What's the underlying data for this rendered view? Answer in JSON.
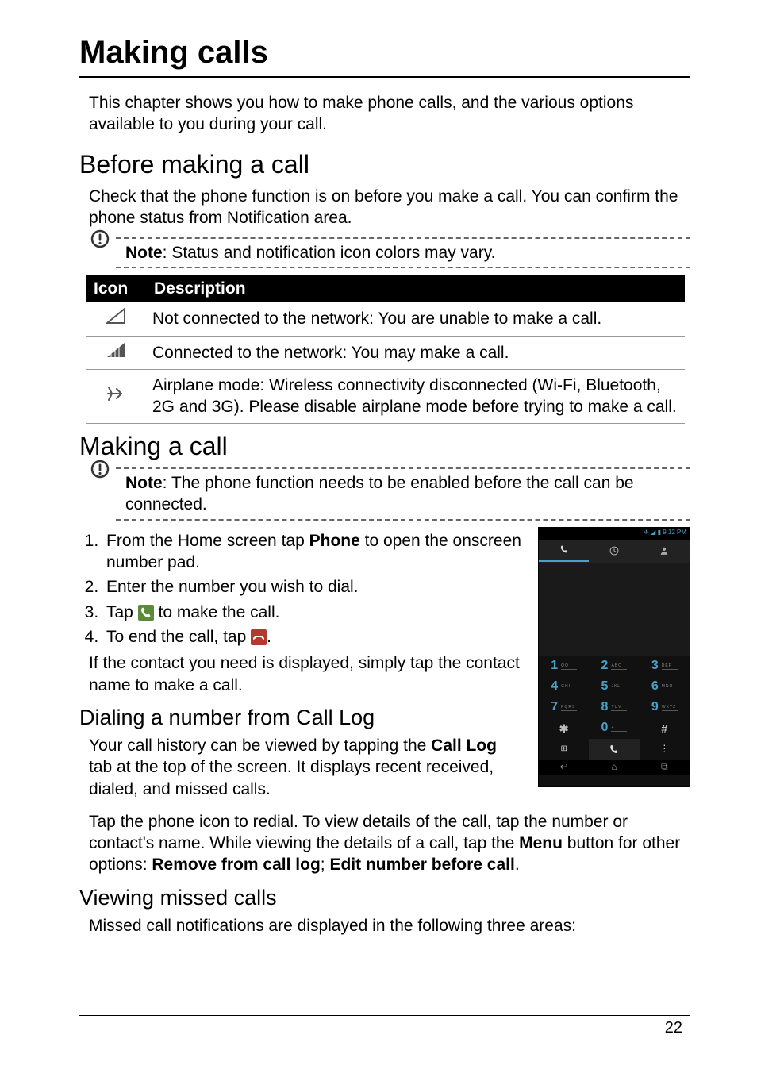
{
  "page": {
    "title": "Making calls",
    "intro": "This chapter shows you how to make phone calls, and the various options available to you during your call.",
    "pageNumber": "22"
  },
  "sec_before": {
    "heading": "Before making a call",
    "text": "Check that the phone function is on before you make a call. You can confirm the phone status from Notification area.",
    "note_prefix": "Note",
    "note_body": ": Status and notification icon colors may vary."
  },
  "table": {
    "h1": "Icon",
    "h2": "Description",
    "rows": [
      "Not connected to the network: You are unable to make a call.",
      "Connected to the network: You may make a call.",
      "Airplane mode: Wireless connectivity disconnected (Wi-Fi, Bluetooth, 2G and 3G). Please disable airplane mode before trying to make a call."
    ]
  },
  "sec_making": {
    "heading": "Making a call",
    "note_prefix": "Note",
    "note_body": ": The phone function needs to be enabled before the call can be connected.",
    "steps": {
      "s1a": "From the Home screen tap ",
      "s1b": "Phone",
      "s1c": " to open the onscreen number pad.",
      "s2": "Enter the number you wish to dial.",
      "s3a": "Tap ",
      "s3b": " to make the call.",
      "s4a": "To end the call, tap ",
      "s4b": "."
    },
    "after": "If the contact you need is displayed, simply tap the contact name to make a call."
  },
  "sec_calllog": {
    "heading": "Dialing a number from Call Log",
    "p1a": "Your call history can be viewed by tapping the ",
    "p1b": "Call Log",
    "p1c": " tab at the top of the screen. It displays recent received, dialed, and missed calls.",
    "p2a": "Tap the phone icon to redial. To view details of the call, tap the number or contact's name. While viewing the details of a call, tap the ",
    "p2b": "Menu",
    "p2c": " button for other options: ",
    "p2d": "Remove from call log",
    "p2e": "; ",
    "p2f": "Edit number before call",
    "p2g": "."
  },
  "sec_missed": {
    "heading": "Viewing missed calls",
    "text": "Missed call notifications are displayed in the following three areas:"
  },
  "phone": {
    "status_time": "9:12 PM",
    "keys": {
      "k1n": "1",
      "k1l": "QO",
      "k2n": "2",
      "k2l": "ABC",
      "k3n": "3",
      "k3l": "DEF",
      "k4n": "4",
      "k4l": "GHI",
      "k5n": "5",
      "k5l": "JKL",
      "k6n": "6",
      "k6l": "MNO",
      "k7n": "7",
      "k7l": "PQRS",
      "k8n": "8",
      "k8l": "TUV",
      "k9n": "9",
      "k9l": "WXYZ",
      "kstar": "✱",
      "k0n": "0",
      "k0l": "+",
      "khash": "#"
    }
  }
}
